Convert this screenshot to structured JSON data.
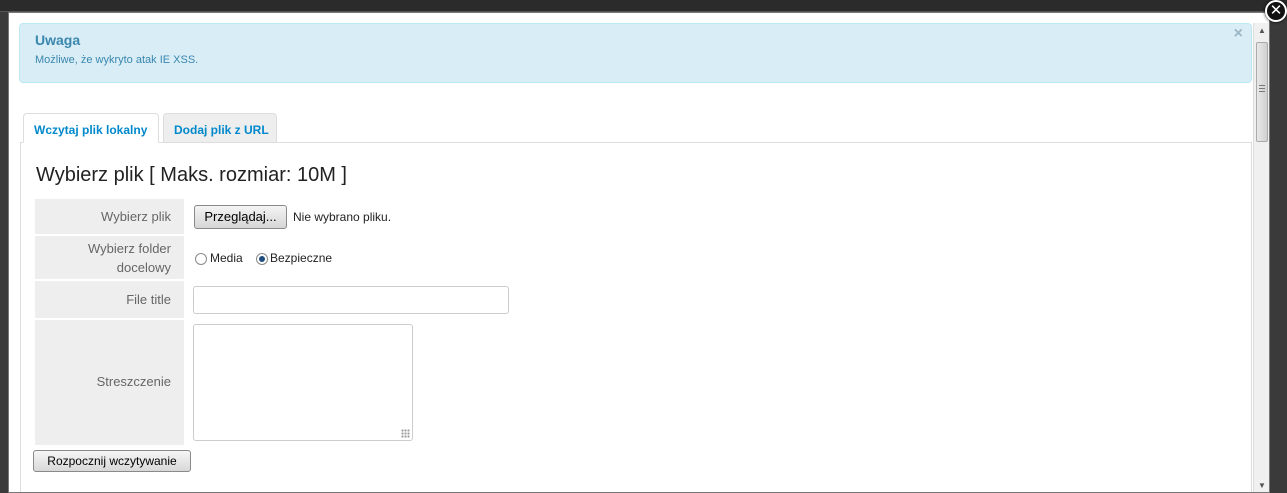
{
  "window": {
    "close_symbol": "✕"
  },
  "alert": {
    "title": "Uwaga",
    "message": "Możliwe, że wykryto atak IE XSS.",
    "close_symbol": "×"
  },
  "tabs": [
    {
      "label": "Wczytaj plik lokalny",
      "active": true
    },
    {
      "label": "Dodaj plik z URL",
      "active": false
    }
  ],
  "form": {
    "heading": "Wybierz plik [ Maks. rozmiar: 10M ]",
    "file": {
      "label": "Wybierz plik",
      "button": "Przeglądaj...",
      "status": "Nie wybrano pliku."
    },
    "folder": {
      "label_line1": "Wybierz folder",
      "label_line2": "docelowy",
      "options": [
        {
          "label": "Media",
          "checked": false
        },
        {
          "label": "Bezpieczne",
          "checked": true
        }
      ]
    },
    "title": {
      "label": "File title",
      "value": ""
    },
    "summary": {
      "label": "Streszczenie",
      "value": ""
    },
    "submit": "Rozpocznij wczytywanie"
  },
  "icons": {
    "close": "close-icon",
    "scroll_up": "chevron-up-icon",
    "scroll_down": "chevron-down-icon"
  },
  "colors": {
    "alert_bg": "#d9edf7",
    "alert_text": "#3a87ad",
    "tab_link": "#0088cc"
  }
}
